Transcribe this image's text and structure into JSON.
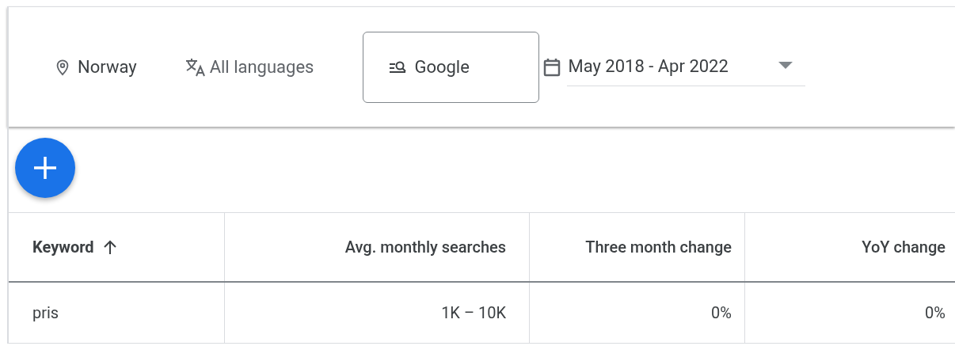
{
  "filters": {
    "location": "Norway",
    "language": "All languages",
    "network": "Google",
    "date_range": "May 2018 - Apr 2022"
  },
  "table": {
    "columns": [
      {
        "label": "Keyword",
        "sorted": true
      },
      {
        "label": "Avg. monthly searches",
        "sorted": false
      },
      {
        "label": "Three month change",
        "sorted": false
      },
      {
        "label": "YoY change",
        "sorted": false
      }
    ],
    "rows": [
      [
        "pris",
        "1K – 10K",
        "0%",
        "0%"
      ]
    ]
  }
}
